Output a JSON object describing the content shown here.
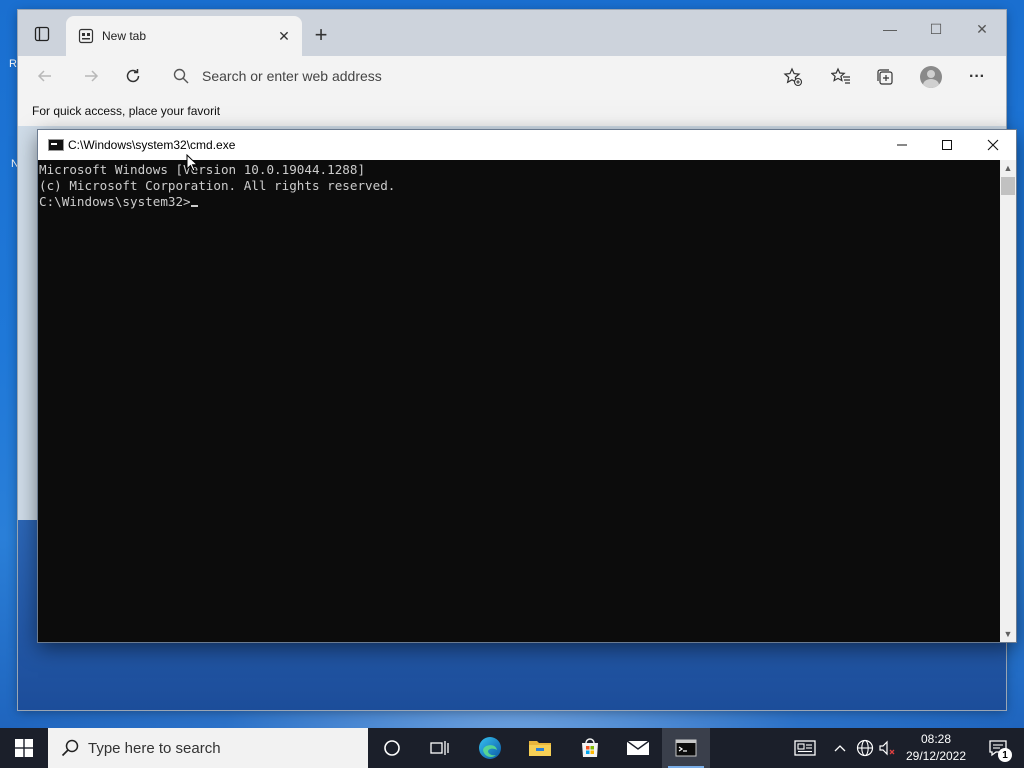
{
  "desktop": {
    "edge_letters": [
      "R",
      "N"
    ]
  },
  "browser": {
    "tab_title": "New tab",
    "tab_close": "✕",
    "new_tab": "+",
    "window_controls": {
      "minimize": "—",
      "maximize": "☐",
      "close": "✕"
    },
    "address_placeholder": "Search or enter web address",
    "favorites_bar_text": "For quick access, place your favorit",
    "more_menu": "···"
  },
  "cmd": {
    "title": "C:\\Windows\\system32\\cmd.exe",
    "lines": [
      "Microsoft Windows [Version 10.0.19044.1288]",
      "(c) Microsoft Corporation. All rights reserved.",
      "",
      "C:\\Windows\\system32>"
    ],
    "controls": {
      "minimize": "—",
      "maximize": "☐",
      "close": "✕"
    }
  },
  "taskbar": {
    "search_placeholder": "Type here to search",
    "pinned": [
      "cortana-icon",
      "task-view-icon",
      "edge-icon",
      "file-explorer-icon",
      "store-icon",
      "mail-icon",
      "cmd-icon"
    ],
    "clock": {
      "time": "08:28",
      "date": "29/12/2022"
    },
    "notification_count": "1"
  },
  "colors": {
    "taskbar": "#1b1f2a",
    "cmd_background": "#0c0c0c",
    "cmd_text": "#cccccc",
    "browser_chrome": "#cdd3dc"
  }
}
